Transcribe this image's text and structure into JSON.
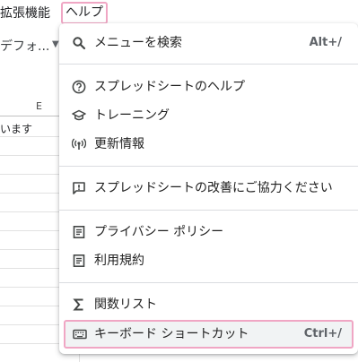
{
  "menubar": {
    "extensions_label": "拡張機能",
    "help_label": "ヘルプ"
  },
  "toolbar": {
    "font_label": "デフォ..."
  },
  "sheet": {
    "column_e": "E",
    "cell_text": "います"
  },
  "help_menu": {
    "items": [
      {
        "label": "メニューを検索",
        "shortcut": "Alt+/",
        "icon": "search-icon"
      },
      {
        "label": "スプレッドシートのヘルプ",
        "icon": "help-circle-icon"
      },
      {
        "label": "トレーニング",
        "icon": "graduation-cap-icon"
      },
      {
        "label": "更新情報",
        "icon": "broadcast-icon"
      },
      {
        "label": "スプレッドシートの改善にご協力ください",
        "icon": "feedback-icon"
      },
      {
        "label": "プライバシー ポリシー",
        "icon": "document-icon"
      },
      {
        "label": "利用規約",
        "icon": "document-icon"
      },
      {
        "label": "関数リスト",
        "icon": "sigma-icon"
      },
      {
        "label": "キーボード ショートカット",
        "shortcut": "Ctrl+/",
        "icon": "keyboard-icon"
      }
    ]
  },
  "colors": {
    "highlight_border": "#f0a6c4",
    "icon": "#444746",
    "separator": "#dadce0"
  }
}
